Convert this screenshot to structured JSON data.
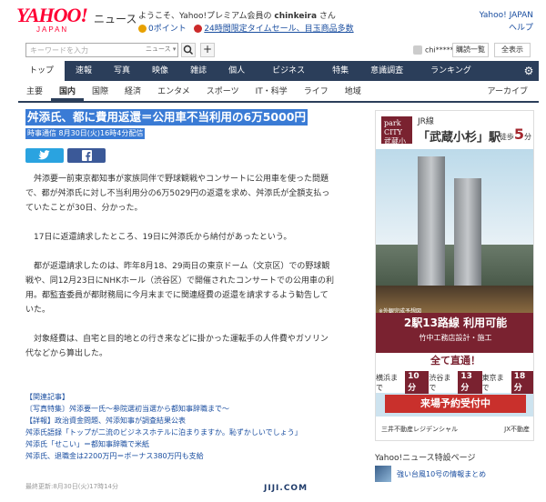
{
  "header": {
    "logo_main": "YAHOO!",
    "logo_sub": "JAPAN",
    "brand": "ニュース",
    "welcome_prefix": "ようこそ、Yahoo!プレミアム会員の",
    "username": "chinkeira",
    "welcome_suffix": "さん",
    "points": "0ポイント",
    "timesale": "24時間限定タイムセール、目玉商品多数",
    "link_yahoo": "Yahoo! JAPAN",
    "link_help": "ヘルプ"
  },
  "search": {
    "placeholder": "キーワードを入力",
    "scope": "ニュース ▾",
    "plus": "+",
    "user_short": "chi*****",
    "history_label": "購読一覧",
    "subscribe_label": "全表示"
  },
  "topnav": [
    "トップ",
    "速報",
    "写真",
    "映像",
    "雑誌",
    "個人",
    "ビジネス",
    "特集",
    "意識調査",
    "ランキング"
  ],
  "topnav_active": 0,
  "subnav": [
    "主要",
    "国内",
    "国際",
    "経済",
    "エンタメ",
    "スポーツ",
    "IT・科学",
    "ライフ",
    "地域"
  ],
  "subnav_active": 1,
  "archive": "アーカイブ",
  "article": {
    "headline": "舛添氏、都に費用返還＝公用車不当利用の6万5000円",
    "byline": "時事通信 8月30日(火)16時4分配信",
    "paragraphs": [
      "舛添要一前東京都知事が家族同伴で野球観戦やコンサートに公用車を使った問題で、都が舛添氏に対し不当利用分の6万5029円の返還を求め、舛添氏が全額支払っていたことが30日、分かった。",
      "17日に返還請求したところ、19日に舛添氏から納付があったという。",
      "都が返還請求したのは、昨年8月18、29両日の東京ドーム（文京区）での野球観戦や、同12月23日にNHKホール（渋谷区）で開催されたコンサートでの公用車の利用。都監査委員が都財務局に今月末までに関連経費の返還を請求するよう勧告していた。",
      "対象経費は、自宅と目的地との行き来などに掛かった運転手の人件費やガソリン代などから算出した。"
    ],
    "related_heading": "【関連記事】",
    "related": [
      "〔写真特集〕舛添要一氏～参院選初当選から都知事辞職まで～",
      "【詳報】政治資金問題、舛添知事が調査結果公表",
      "舛添氏語録「トップが二流のビジネスホテルに泊まりますか。恥ずかしいでしょう」",
      "舛添氏「せこい」＝都知事辞職で米紙",
      "舛添氏、退職金は2200万円＝ボーナス380万円も支給"
    ],
    "updated": "最終更新:8月30日(火)17時14分",
    "footer_logo": "JIJI.COM"
  },
  "ad": {
    "park": "park CITY 武蔵小杉",
    "line": "JR線",
    "station": "「武蔵小杉」駅",
    "walk_prefix": "徒歩",
    "walk_min": "5",
    "walk_suffix": "分",
    "photo_caption": "※外観完成予想図",
    "access": "2駅13路線 利用可能",
    "contractor": "竹中工務店設計・施工",
    "open_all": "全て直通！",
    "stations": [
      {
        "name": "横浜まで",
        "min": "10分"
      },
      {
        "name": "渋谷まで",
        "min": "13分"
      },
      {
        "name": "東京まで",
        "min": "18分"
      }
    ],
    "cta": "来場予約受付中",
    "sponsor1": "三井不動産レジデンシャル",
    "sponsor2": "JX不動産"
  },
  "sidebar": {
    "special_heading": "Yahoo!ニュース特設ページ",
    "special_item": "強い台風10号の情報まとめ"
  }
}
